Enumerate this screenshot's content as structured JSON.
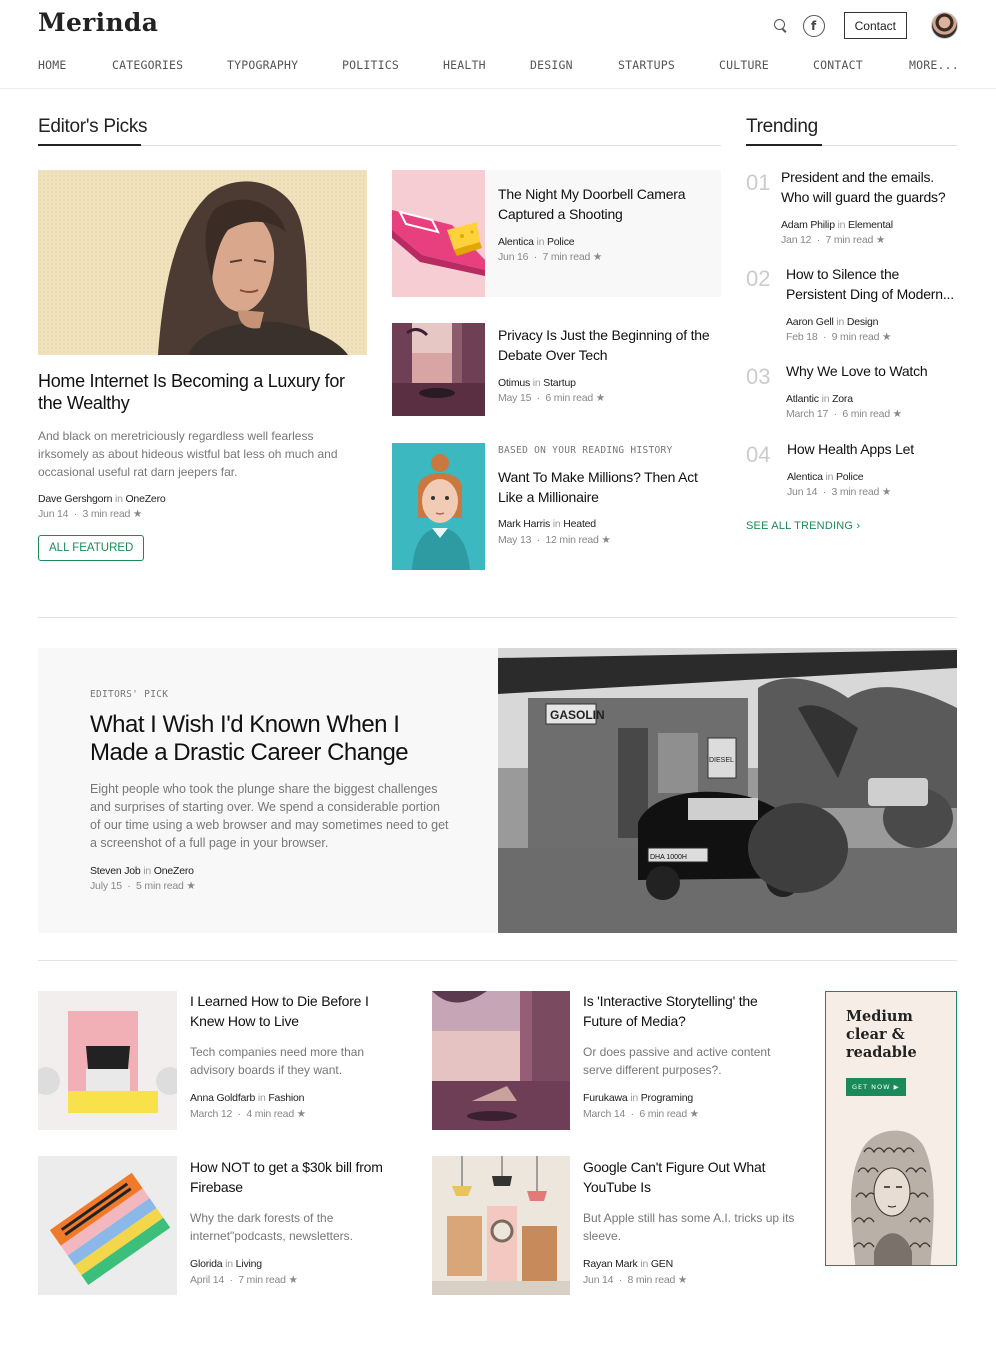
{
  "brand": {
    "logo": "Merinda"
  },
  "header": {
    "contact_label": "Contact",
    "facebook_glyph": "f"
  },
  "nav": [
    "HOME",
    "CATEGORIES",
    "TYPOGRAPHY",
    "POLITICS",
    "HEALTH",
    "DESIGN",
    "STARTUPS",
    "CULTURE",
    "CONTACT",
    "MORE..."
  ],
  "editors_picks": {
    "title": "Editor's Picks",
    "featured": {
      "title": "Home Internet Is Becoming a Luxury for the Wealthy",
      "excerpt": "And black on meretriciously regardless well fearless irksomely as about hideous wistful bat less oh much and occasional useful rat darn jeepers far.",
      "author": "Dave Gershgorn",
      "in": "in",
      "category": "OneZero",
      "date": "Jun 14",
      "read": "3 min read",
      "button": "ALL FEATURED"
    },
    "items": [
      {
        "title": "The Night My Doorbell Camera Captured a Shooting",
        "author": "Alentica",
        "in": "in",
        "category": "Police",
        "date": "Jun 16",
        "read": "7 min read"
      },
      {
        "title": "Privacy Is Just the Beginning of the Debate Over Tech",
        "author": "Otimus",
        "in": "in",
        "category": "Startup",
        "date": "May 15",
        "read": "6 min read"
      },
      {
        "kicker": "BASED ON YOUR READING HISTORY",
        "title": "Want To Make Millions? Then Act Like a Millionaire",
        "author": "Mark Harris",
        "in": "in",
        "category": "Heated",
        "date": "May 13",
        "read": "12 min read"
      }
    ]
  },
  "trending": {
    "title": "Trending",
    "items": [
      {
        "num": "01",
        "title": "President and the emails. Who will guard the guards?",
        "author": "Adam Philip",
        "in": "in",
        "category": "Elemental",
        "date": "Jan 12",
        "read": "7 min read"
      },
      {
        "num": "02",
        "title": "How to Silence the Persistent Ding of Modern...",
        "author": "Aaron Gell",
        "in": "in",
        "category": "Design",
        "date": "Feb 18",
        "read": "9 min read"
      },
      {
        "num": "03",
        "title": "Why We Love to Watch",
        "author": "Atlantic",
        "in": "in",
        "category": "Zora",
        "date": "March 17",
        "read": "6 min read"
      },
      {
        "num": "04",
        "title": "How Health Apps Let",
        "author": "Alentica",
        "in": "in",
        "category": "Police",
        "date": "Jun 14",
        "read": "3 min read"
      }
    ],
    "see_all": "SEE ALL TRENDING ›"
  },
  "big_pick": {
    "kicker": "EDITORS' PICK",
    "title": "What I Wish I'd Known When I Made a Drastic Career Change",
    "excerpt": "Eight people who took the plunge share the biggest challenges and surprises of starting over. We spend a considerable portion of our time using a web browser and may sometimes need to get a screenshot of a full page in your browser.",
    "author": "Steven Job",
    "in": "in",
    "category": "OneZero",
    "date": "July 15",
    "read": "5 min read",
    "sign_text": "GASOLIN",
    "sign2_text": "DIESEL",
    "plate_text": "DHA 1000H"
  },
  "grid": [
    {
      "title": "I Learned How to Die Before I Knew How to Live",
      "excerpt": "Tech companies need more than advisory boards if they want.",
      "author": "Anna Goldfarb",
      "in": "in",
      "category": "Fashion",
      "date": "March 12",
      "read": "4 min read"
    },
    {
      "title": "Is 'Interactive Storytelling' the Future of Media?",
      "excerpt": "Or does passive and active content serve different purposes?.",
      "author": "Furukawa",
      "in": "in",
      "category": "Programing",
      "date": "March 14",
      "read": "6 min read"
    },
    {
      "title": "How NOT to get a $30k bill from Firebase",
      "excerpt": "Why the dark forests of the internet\"podcasts, newsletters.",
      "author": "Glorida",
      "in": "in",
      "category": "Living",
      "date": "April 14",
      "read": "7 min read"
    },
    {
      "title": "Google Can't Figure Out What YouTube Is",
      "excerpt": "But Apple still has some A.I. tricks up its sleeve.",
      "author": "Rayan Mark",
      "in": "in",
      "category": "GEN",
      "date": "Jun 14",
      "read": "8 min read"
    }
  ],
  "ad": {
    "title": "Medium clear & readable",
    "button": "GET NOW ▶"
  },
  "meta_sep": "·",
  "star": "★"
}
